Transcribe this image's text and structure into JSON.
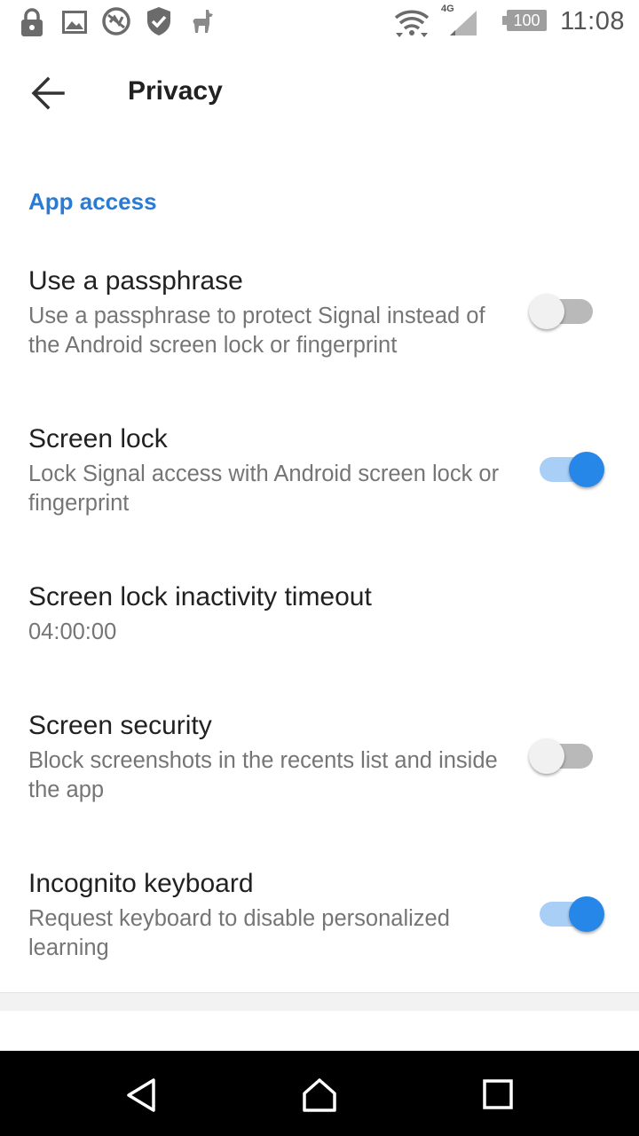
{
  "status_bar": {
    "time": "11:08",
    "network_type": "4G",
    "battery_level": "100",
    "icons": [
      "lock-icon",
      "image-icon",
      "globe-block-icon",
      "shield-icon",
      "llama-icon",
      "wifi-icon",
      "cell-signal-icon",
      "battery-icon"
    ]
  },
  "toolbar": {
    "back_icon": "arrow-left-icon",
    "title": "Privacy"
  },
  "section": {
    "header": "App access"
  },
  "preferences": [
    {
      "title": "Use a passphrase",
      "summary": "Use a passphrase to protect Signal instead of the Android screen lock or fingerprint",
      "switch_on": false
    },
    {
      "title": "Screen lock",
      "summary": "Lock Signal access with Android screen lock or fingerprint",
      "switch_on": true
    },
    {
      "title": "Screen lock inactivity timeout",
      "summary": "04:00:00"
    },
    {
      "title": "Screen security",
      "summary": "Block screenshots in the recents list and inside the app",
      "switch_on": false
    },
    {
      "title": "Incognito keyboard",
      "summary": "Request keyboard to disable personalized learning",
      "switch_on": true
    }
  ],
  "nav_bar": {
    "icons": [
      "back-triangle-icon",
      "home-icon",
      "recents-icon"
    ]
  },
  "colors": {
    "accent": "#2a7bd3",
    "switch_on_thumb": "#2787e9",
    "switch_on_track": "#a9cff7",
    "switch_off_thumb": "#f1f1f1",
    "switch_off_track": "#b9b9b9",
    "title_text": "#212121",
    "summary_text": "#757575"
  }
}
